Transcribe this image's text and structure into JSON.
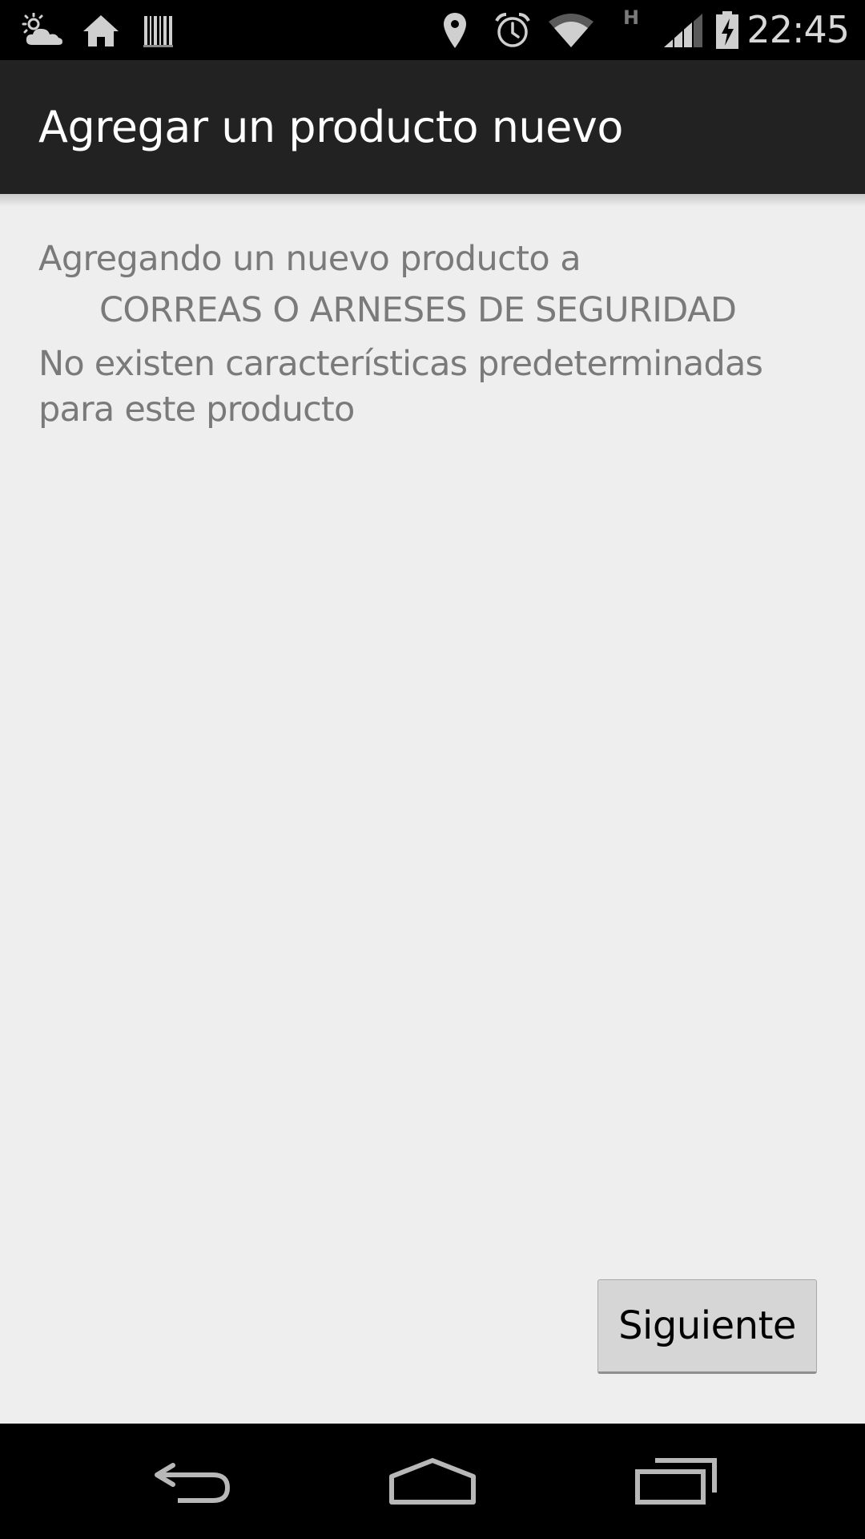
{
  "status_bar": {
    "time": "22:45",
    "network_type": "H",
    "icons": [
      "weather-partly-cloudy-icon",
      "home-icon",
      "barcode-icon",
      "location-pin-icon",
      "alarm-clock-icon",
      "wifi-icon",
      "signal-strength-icon",
      "battery-charging-icon"
    ]
  },
  "action_bar": {
    "title": "Agregar un producto nuevo"
  },
  "content": {
    "intro": "Agregando un nuevo producto a",
    "category": "CORREAS O ARNESES DE SEGURIDAD",
    "message": "No existen características predeterminadas para este producto"
  },
  "buttons": {
    "next_label": "Siguiente"
  },
  "nav_bar": {
    "icons": [
      "back-icon",
      "home-nav-icon",
      "recent-apps-icon"
    ]
  },
  "colors": {
    "status_bar": "#000000",
    "action_bar": "#222222",
    "background": "#eeeeee",
    "content_text": "#7a7a7a",
    "button_bg": "#d6d6d6"
  }
}
